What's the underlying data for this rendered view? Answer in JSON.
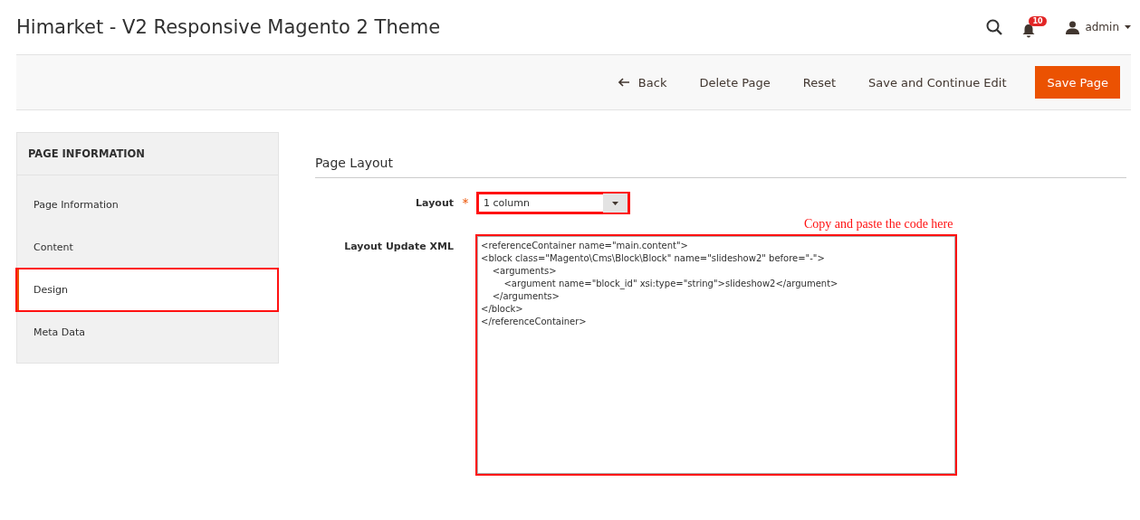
{
  "header": {
    "title": "Himarket - V2 Responsive Magento 2 Theme",
    "notifications_count": "10",
    "user": "admin"
  },
  "actions": [
    {
      "label": "Back",
      "kind": "back"
    },
    {
      "label": "Delete Page",
      "kind": "plain"
    },
    {
      "label": "Reset",
      "kind": "plain"
    },
    {
      "label": "Save and Continue Edit",
      "kind": "plain"
    },
    {
      "label": "Save Page",
      "kind": "primary"
    }
  ],
  "sidebar": {
    "title": "PAGE INFORMATION",
    "items": [
      {
        "label": "Page Information",
        "selected": false,
        "highlighted": false
      },
      {
        "label": "Content",
        "selected": false,
        "highlighted": false
      },
      {
        "label": "Design",
        "selected": true,
        "highlighted": true
      },
      {
        "label": "Meta Data",
        "selected": false,
        "highlighted": false
      }
    ]
  },
  "section": {
    "title": "Page Layout",
    "layout": {
      "label": "Layout",
      "required_mark": "*",
      "value": "1 column",
      "highlighted": true
    },
    "note": "Copy and paste the code here",
    "xml": {
      "label": "Layout Update XML",
      "highlighted": true,
      "value": "<referenceContainer name=\"main.content\">\n<block class=\"Magento\\Cms\\Block\\Block\" name=\"slideshow2\" before=\"-\">\n\t<arguments>\n\t\t<argument name=\"block_id\" xsi:type=\"string\">slideshow2</argument>\n\t</arguments>\n</block>\n</referenceContainer>"
    }
  }
}
